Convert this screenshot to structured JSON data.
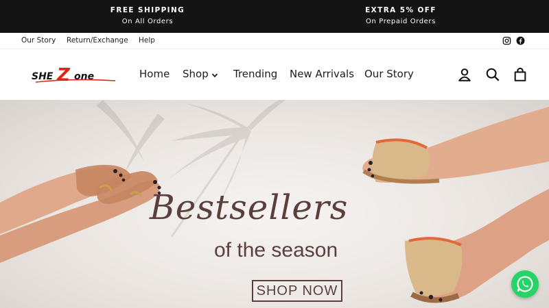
{
  "announcements": [
    {
      "title": "FREE SHIPPING",
      "subtitle": "On All Orders"
    },
    {
      "title": "EXTRA 5% OFF",
      "subtitle": "On Prepaid Orders"
    }
  ],
  "utility_links": [
    "Our Story",
    "Return/Exchange",
    "Help"
  ],
  "social_icons": [
    "instagram-icon",
    "facebook-icon"
  ],
  "logo": {
    "text_left": "SHE",
    "text_mid": "Z",
    "text_right": "one",
    "accent_color": "#e2231a"
  },
  "nav": [
    "Home",
    "Shop",
    "Trending",
    "New Arrivals",
    "Our Story"
  ],
  "header_icons": [
    "account-icon",
    "search-icon",
    "cart-icon"
  ],
  "hero": {
    "title": "Bestsellers",
    "subtitle": "of the season",
    "button": "SHOP NOW",
    "text_color": "#5b3f3d"
  },
  "chat_widget": {
    "icon": "whatsapp-icon",
    "color": "#25d366"
  }
}
